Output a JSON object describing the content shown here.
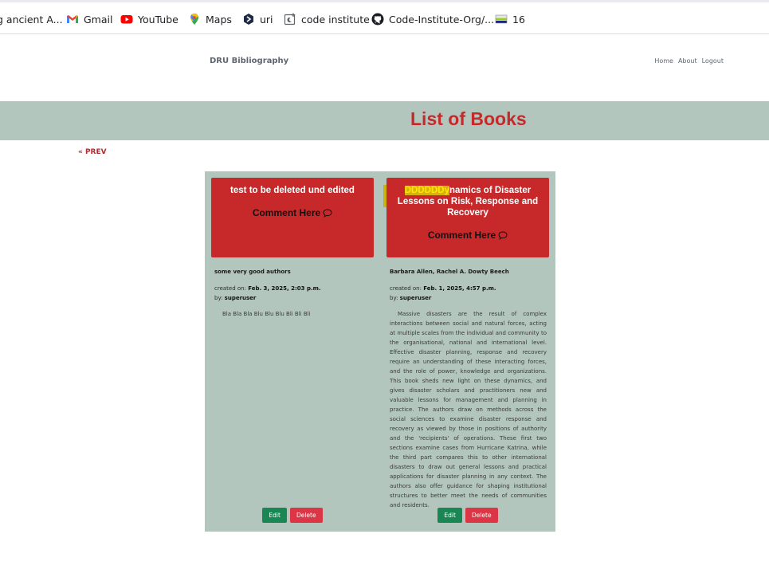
{
  "bookmarks": [
    {
      "label": "g ancient A...",
      "icon": "page-icon"
    },
    {
      "label": "Gmail",
      "icon": "gmail-icon"
    },
    {
      "label": "YouTube",
      "icon": "youtube-icon"
    },
    {
      "label": "Maps",
      "icon": "maps-icon"
    },
    {
      "label": "uri",
      "icon": "hex-icon"
    },
    {
      "label": "code institute",
      "icon": "code-institute-icon"
    },
    {
      "label": "Code-Institute-Org/...",
      "icon": "github-icon"
    },
    {
      "label": "16",
      "icon": "folder-flag-icon"
    }
  ],
  "nav": {
    "brand": "DRU Bibliography",
    "links": [
      "Home",
      "About",
      "Logout"
    ]
  },
  "page": {
    "title": "List of Books",
    "prev_label": "« PREV"
  },
  "books": [
    {
      "title": "test to be deleted und edited",
      "comment_label": "Comment Here",
      "authors": "some very good authors",
      "created_label": "created on:",
      "created": "Feb. 3, 2025, 2:03 p.m.",
      "by_label": "by:",
      "by": "superuser",
      "description": "Bla Bla Bla Blu Blu Blu Bli Bli Bli",
      "edit_label": "Edit",
      "delete_label": "Delete"
    },
    {
      "title_highlight": "DDDDDDy",
      "title_rest": "namics of Disaster Lessons on Risk, Response and Recovery",
      "comment_label": "Comment Here",
      "authors": "Barbara Allen, Rachel A. Dowty Beech",
      "created_label": "created on:",
      "created": "Feb. 1, 2025, 4:57 p.m.",
      "by_label": "by:",
      "by": "superuser",
      "description": "Massive disasters are the result of complex interactions between social and natural forces, acting at multiple scales from the individual and community to the organisational, national and international level. Effective disaster planning, response and recovery require an understanding of these interacting forces, and the role of power, knowledge and organizations. This book sheds new light on these dynamics, and gives disaster scholars and practitioners new and valuable lessons for management and planning in practice. The authors draw on methods across the social sciences to examine disaster response and recovery as viewed by those in positions of authority and the 'recipients' of operations. These first two sections examine cases from Hurricane Katrina, while the third part compares this to other international disasters to draw out general lessons and practical applications for disaster planning in any context. The authors also offer guidance for shaping institutional structures to better meet the needs of communities and residents.",
      "edit_label": "Edit",
      "delete_label": "Delete"
    }
  ],
  "colors": {
    "accent_red": "#c7292b",
    "band_green": "#b3c6bd",
    "edit_green": "#198754",
    "delete_red": "#dc3545",
    "highlight_yellow": "#ffe600"
  }
}
